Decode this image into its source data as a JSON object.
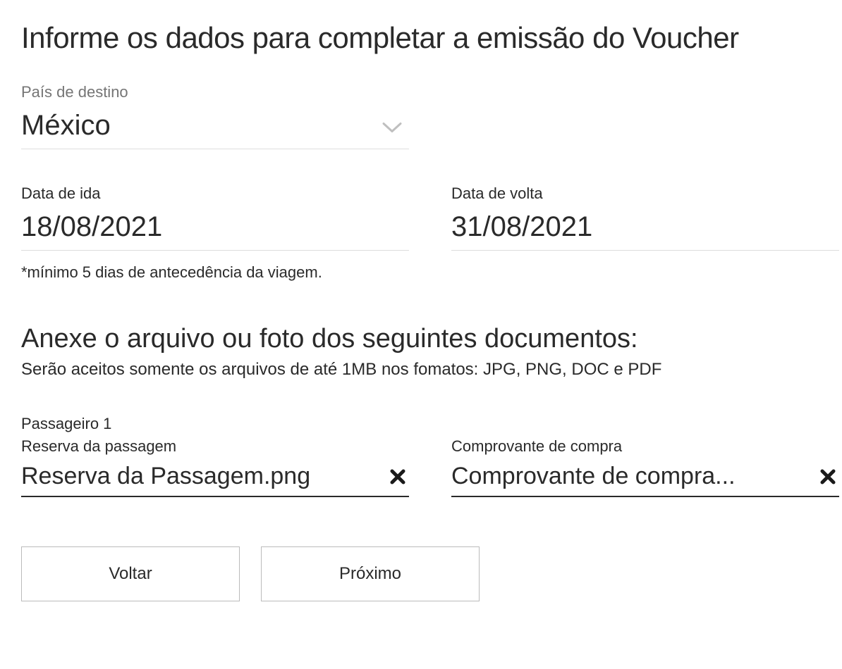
{
  "heading": "Informe os dados para completar a emissão do Voucher",
  "destination": {
    "label": "País de destino",
    "value": "México"
  },
  "departure": {
    "label": "Data de ida",
    "value": "18/08/2021",
    "hint": "*mínimo 5 dias de antecedência da viagem."
  },
  "return": {
    "label": "Data de volta",
    "value": "31/08/2021"
  },
  "attach": {
    "heading": "Anexe o arquivo ou foto dos seguintes documentos:",
    "subtext": "Serão aceitos somente os arquivos de até 1MB  nos fomatos: JPG, PNG, DOC e PDF"
  },
  "passenger_label": "Passageiro 1",
  "uploads": {
    "reservation": {
      "label": "Reserva da passagem",
      "filename": "Reserva da Passagem.png"
    },
    "receipt": {
      "label": "Comprovante de compra",
      "filename": "Comprovante de compra..."
    }
  },
  "buttons": {
    "back": "Voltar",
    "next": "Próximo"
  }
}
